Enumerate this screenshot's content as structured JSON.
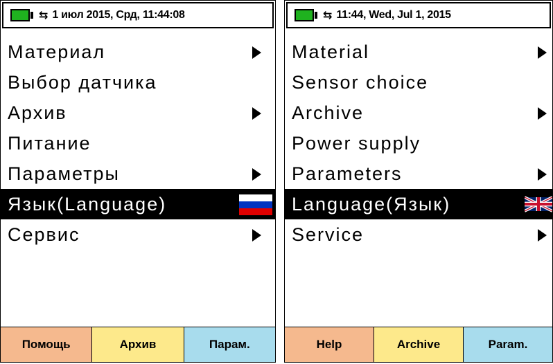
{
  "colors": {
    "battery": "#1fb21f",
    "selected_bg": "#000000",
    "help_key": "#f5b98e",
    "archive_key": "#fde98b",
    "param_key": "#a8dced"
  },
  "icons": {
    "battery": "battery-icon",
    "usb": "usb-icon",
    "submenu": "triangle-right-icon",
    "ru_flag": "russian-flag-icon",
    "uk_flag": "uk-flag-icon"
  },
  "usb_glyph": "⭠⭢",
  "screen_ru": {
    "status": "1 июл 2015, Срд, 11:44:08",
    "menu": [
      {
        "label": "Материал",
        "submenu": true
      },
      {
        "label": "Выбор датчика",
        "submenu": false
      },
      {
        "label": "Архив",
        "submenu": true
      },
      {
        "label": "Питание",
        "submenu": false
      },
      {
        "label": "Параметры",
        "submenu": true
      },
      {
        "label": "Язык(Language)",
        "submenu": false,
        "selected": true
      },
      {
        "label": "Сервис",
        "submenu": true
      }
    ],
    "softkeys": [
      "Помощь",
      "Архив",
      "Парам."
    ]
  },
  "screen_en": {
    "status": "11:44, Wed, Jul 1, 2015",
    "menu": [
      {
        "label": "Material",
        "submenu": true
      },
      {
        "label": "Sensor choice",
        "submenu": false
      },
      {
        "label": "Archive",
        "submenu": true
      },
      {
        "label": "Power supply",
        "submenu": false
      },
      {
        "label": "Parameters",
        "submenu": true
      },
      {
        "label": "Language(Язык)",
        "submenu": false,
        "selected": true
      },
      {
        "label": "Service",
        "submenu": true
      }
    ],
    "softkeys": [
      "Help",
      "Archive",
      "Param."
    ]
  }
}
